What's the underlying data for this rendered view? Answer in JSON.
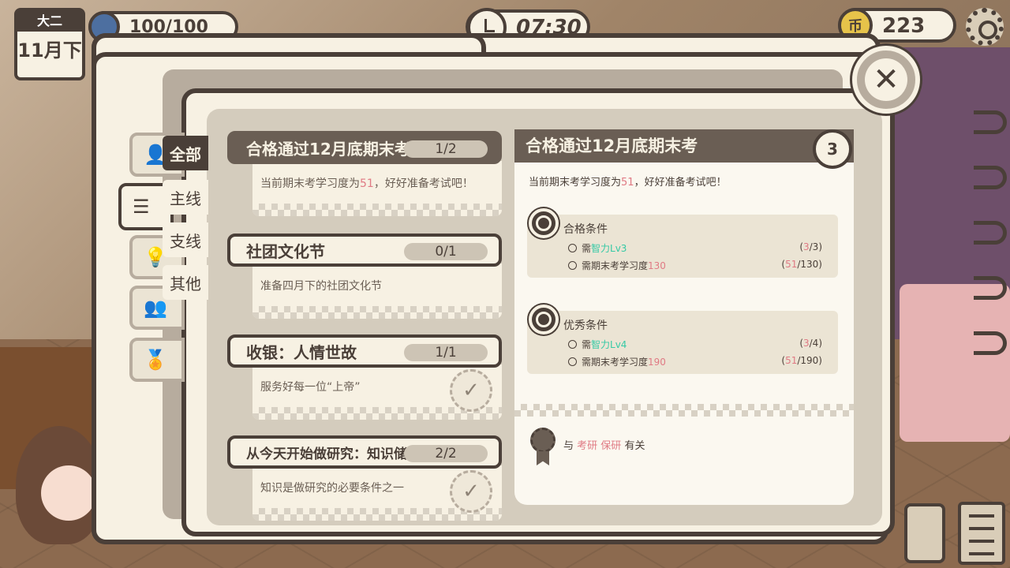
{
  "hud": {
    "grade": "大二",
    "month": "11月下",
    "energy": "100/100",
    "time": "07:30",
    "coin_symbol": "币",
    "coins": "223"
  },
  "categories": [
    {
      "label": "全部",
      "active": true
    },
    {
      "label": "主线",
      "active": false
    },
    {
      "label": "支线",
      "active": false
    },
    {
      "label": "其他",
      "active": false
    }
  ],
  "quests": [
    {
      "title": "合格通过12月底期末考",
      "progress": "1/2",
      "desc_prefix": "当前期末考学习度为",
      "desc_highlight": "51",
      "desc_suffix": "，好好准备考试吧！",
      "selected": true,
      "completed": false
    },
    {
      "title": "社团文化节",
      "progress": "0/1",
      "desc_prefix": "准备四月下的社团文化节",
      "desc_highlight": "",
      "desc_suffix": "",
      "selected": false,
      "completed": false
    },
    {
      "title": "收银：人情世故",
      "progress": "1/1",
      "desc_prefix": "服务好每一位“上帝”",
      "desc_highlight": "",
      "desc_suffix": "",
      "selected": false,
      "completed": true
    },
    {
      "title": "从今天开始做研究：知识储备",
      "progress": "2/2",
      "desc_prefix": "知识是做研究的必要条件之一",
      "desc_highlight": "",
      "desc_suffix": "",
      "selected": false,
      "completed": true
    }
  ],
  "detail": {
    "title": "合格通过12月底期末考",
    "badge": "3",
    "desc_prefix": "当前期末考学习度为",
    "desc_highlight": "51",
    "desc_suffix": "，好好准备考试吧！",
    "pass": {
      "title": "合格条件",
      "req1_prefix": "需",
      "req1_highlight": "智力Lv3",
      "req1_value_cur": "3",
      "req1_value_rest": "/3)",
      "req2_prefix": "需期末考学习度",
      "req2_highlight": "130",
      "req2_value_cur": "51",
      "req2_value_rest": "/130)"
    },
    "excellent": {
      "title": "优秀条件",
      "req1_prefix": "需",
      "req1_highlight": "智力Lv4",
      "req1_value_cur": "3",
      "req1_value_rest": "/4)",
      "req2_prefix": "需期末考学习度",
      "req2_highlight": "190",
      "req2_value_cur": "51",
      "req2_value_rest": "/190)"
    },
    "related_prefix": "与",
    "related_tags": "考研 保研",
    "related_suffix": "有关"
  },
  "close_symbol": "✕",
  "check_symbol": "✓",
  "colors": {
    "accent_green": "#35c9a5",
    "accent_pink": "#e07a84",
    "dark": "#4a3f38"
  }
}
